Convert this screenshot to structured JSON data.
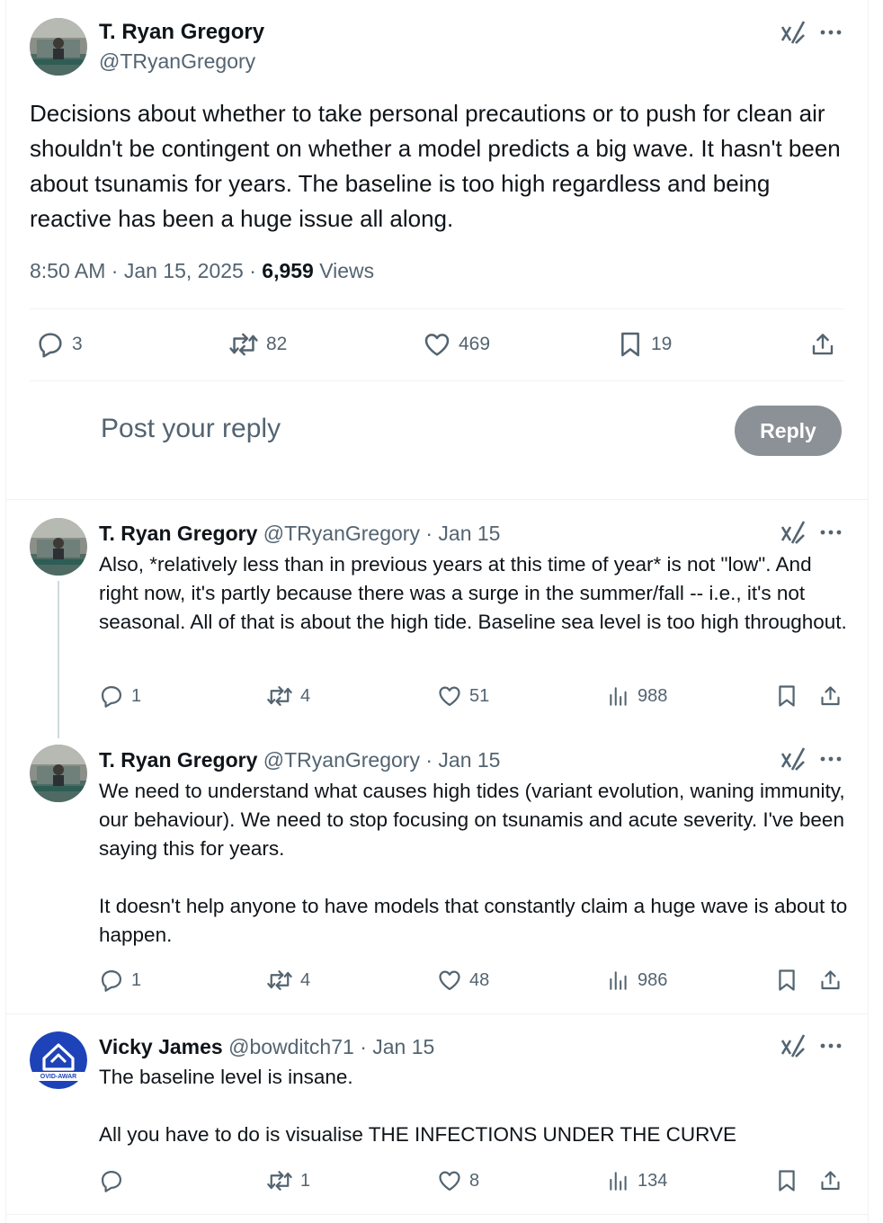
{
  "main_tweet": {
    "author_name": "T. Ryan Gregory",
    "author_handle": "@TRyanGregory",
    "text": "Decisions about whether to take personal precautions or to push for clean air shouldn't be contingent on whether a model predicts a big wave. It hasn't been about tsunamis for years. The baseline is too high regardless and being reactive has been a huge issue all along.",
    "time": "8:50 AM · Jan 15, 2025 · ",
    "views_count": "6,959",
    "views_label": " Views",
    "replies": "3",
    "reposts": "82",
    "likes": "469",
    "bookmarks": "19"
  },
  "compose": {
    "placeholder": "Post your reply",
    "button_label": "Reply"
  },
  "replies": [
    {
      "name": "T. Ryan Gregory",
      "handle": "@TRyanGregory",
      "date": " · Jan 15",
      "text": "Also, *relatively less than in previous years at this time of year* is not \"low\". And right now, it's partly because there was a surge in the summer/fall -- i.e., it's not seasonal. All of that is about the high tide. Baseline sea level is too high throughout.",
      "replies": "1",
      "reposts": "4",
      "likes": "51",
      "views": "988"
    },
    {
      "name": "T. Ryan Gregory",
      "handle": "@TRyanGregory",
      "date": " · Jan 15",
      "text": "We need to understand what causes high tides (variant evolution, waning immunity, our behaviour). We need to stop focusing on tsunamis and acute severity. I've been saying this for years.\n\nIt doesn't help anyone to have models that constantly claim a huge wave is about to happen.",
      "replies": "1",
      "reposts": "4",
      "likes": "48",
      "views": "986"
    },
    {
      "name": "Vicky James",
      "handle": "@bowditch71",
      "date": " · Jan 15",
      "text": "The baseline level is insane.\n\nAll you have to do is visualise THE INFECTIONS UNDER THE CURVE",
      "replies": "",
      "reposts": "1",
      "likes": "8",
      "views": "134",
      "avatar_text": "OVID-AWAR"
    }
  ]
}
